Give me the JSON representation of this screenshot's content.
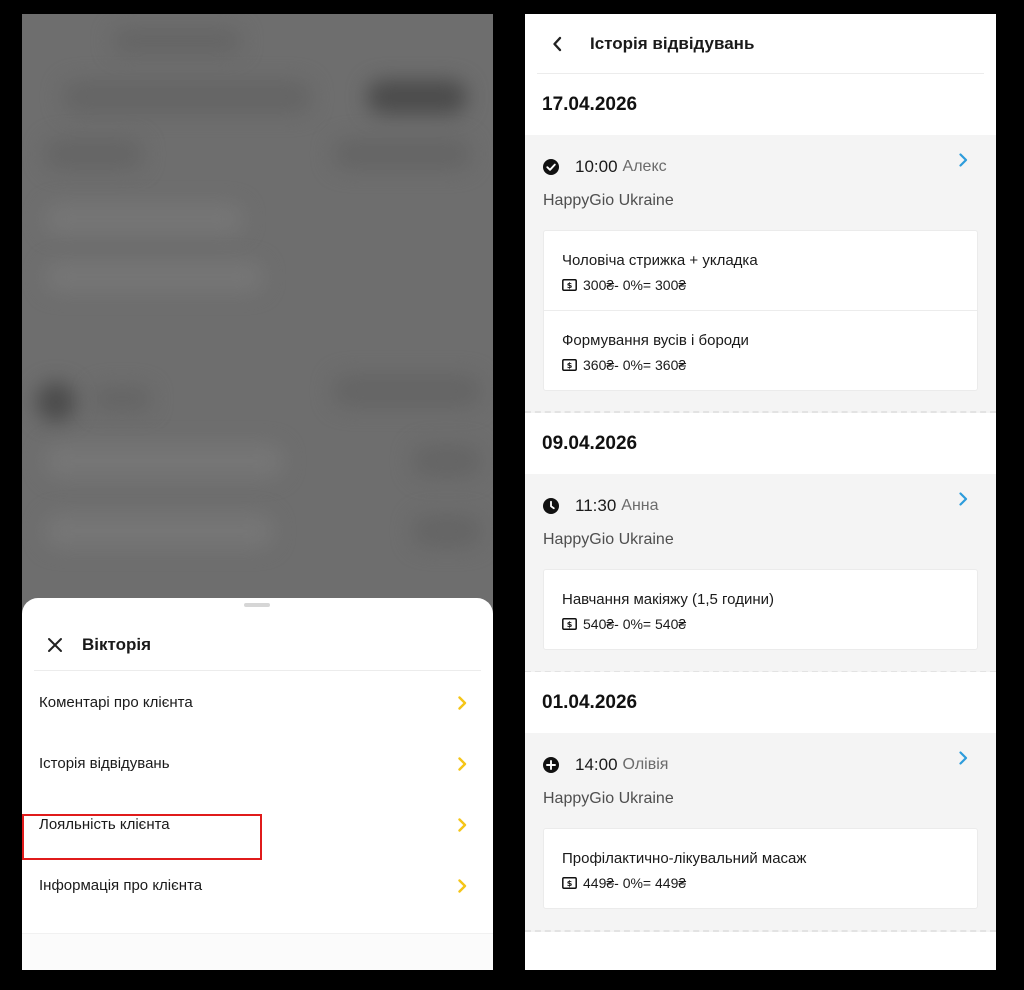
{
  "left_screen": {
    "sheet": {
      "title": "Вікторія",
      "menu": [
        {
          "label": "Коментарі про клієнта"
        },
        {
          "label": "Історія відвідувань"
        },
        {
          "label": "Лояльність клієнта"
        },
        {
          "label": "Інформація про клієнта"
        }
      ],
      "highlighted_item": "Історія відвідувань"
    }
  },
  "right_screen": {
    "title": "Історія відвідувань",
    "visits": [
      {
        "date": "17.04.2026",
        "status_icon": "check-circle-icon",
        "time": "10:00",
        "master": "Алекс",
        "salon": "HappyGio Ukraine",
        "services": [
          {
            "name": "Чоловіча стрижка + укладка",
            "price": "300₴- 0%= 300₴"
          },
          {
            "name": "Формування вусів і бороди",
            "price": "360₴- 0%= 360₴"
          }
        ]
      },
      {
        "date": "09.04.2026",
        "status_icon": "clock-icon",
        "time": "11:30",
        "master": "Анна",
        "salon": "HappyGio Ukraine",
        "services": [
          {
            "name": "Навчання макіяжу (1,5 години)",
            "price": "540₴- 0%= 540₴"
          }
        ]
      },
      {
        "date": "01.04.2026",
        "status_icon": "plus-circle-icon",
        "time": "14:00",
        "master": "Олівія",
        "salon": "HappyGio Ukraine",
        "services": [
          {
            "name": "Профілактично-лікувальний масаж",
            "price": "449₴- 0%= 449₴"
          }
        ]
      }
    ]
  },
  "colors": {
    "accent_yellow": "#F5C518",
    "link_blue": "#2D9CDB",
    "highlight_red": "#E01B1B"
  }
}
